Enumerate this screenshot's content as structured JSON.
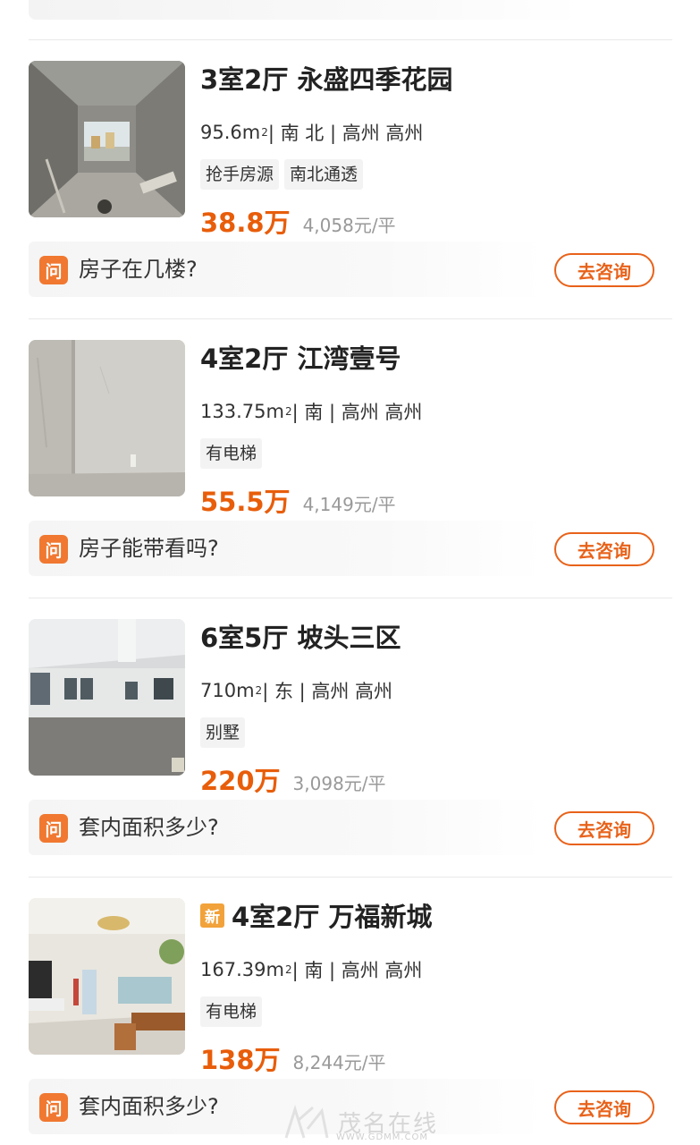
{
  "listings": [
    {
      "title": "3室2厅 永盛四季花园",
      "is_new": false,
      "area": "95.6m",
      "area_sup": "2",
      "meta_rest": " | 南 北 | 高州 高州",
      "tags": [
        "抢手房源",
        "南北通透"
      ],
      "price": "38.8万",
      "unit_price": "4,058元/平",
      "question": "房子在几楼?",
      "question_icon": "问",
      "consult_label": "去咨询",
      "thumb_icon": "photo-unfinished-room-window"
    },
    {
      "title": "4室2厅 江湾壹号",
      "is_new": false,
      "area": "133.75m",
      "area_sup": "2",
      "meta_rest": " | 南 | 高州 高州",
      "tags": [
        "有电梯"
      ],
      "price": "55.5万",
      "unit_price": "4,149元/平",
      "question": "房子能带看吗?",
      "question_icon": "问",
      "consult_label": "去咨询",
      "thumb_icon": "photo-concrete-wall"
    },
    {
      "title": "6室5厅 坡头三区",
      "is_new": false,
      "area": "710m",
      "area_sup": "2",
      "meta_rest": " | 东 | 高州 高州",
      "tags": [
        "别墅"
      ],
      "price": "220万",
      "unit_price": "3,098元/平",
      "question": "套内面积多少?",
      "question_icon": "问",
      "consult_label": "去咨询",
      "thumb_icon": "photo-empty-hall"
    },
    {
      "title": "4室2厅 万福新城",
      "is_new": true,
      "new_badge": "新",
      "area": "167.39m",
      "area_sup": "2",
      "meta_rest": " | 南 | 高州 高州",
      "tags": [
        "有电梯"
      ],
      "price": "138万",
      "unit_price": "8,244元/平",
      "question": "套内面积多少?",
      "question_icon": "问",
      "consult_label": "去咨询",
      "thumb_icon": "photo-furnished-living-room"
    }
  ],
  "colors": {
    "accent": "#e8621a",
    "price": "#e85d0a",
    "new_badge": "#f2a23a"
  },
  "watermark": {
    "text": "茂名在线",
    "url": "WWW.GDMM.COM"
  }
}
